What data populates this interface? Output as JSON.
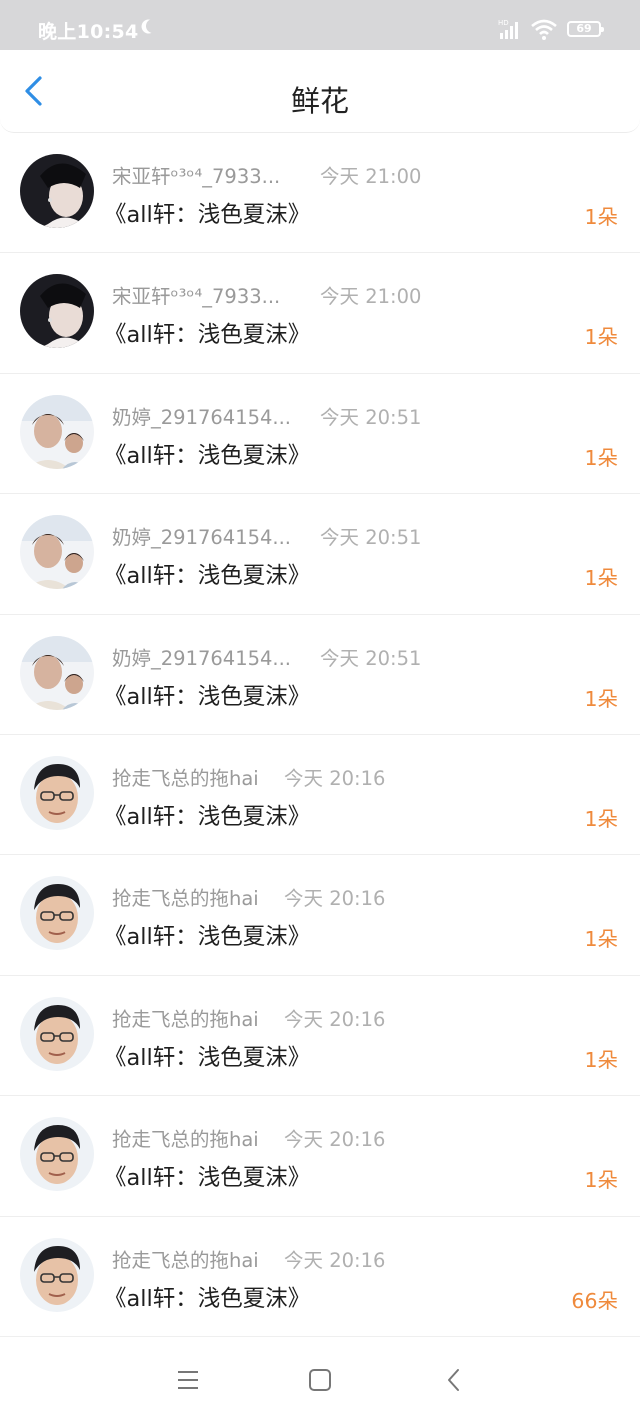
{
  "status_bar": {
    "time": "晚上10:54",
    "battery": "69",
    "icons": [
      "moon-icon",
      "hd-signal-icon",
      "wifi-icon",
      "battery-icon"
    ]
  },
  "header": {
    "title": "鲜花",
    "back_icon": "chevron-left-icon",
    "accent_color": "#2f8ee5"
  },
  "rows": [
    {
      "name": "宋亚轩ᵒ³ᵒ⁴_7933...",
      "time": "今天 21:00",
      "title": "《all轩：浅色夏沫》",
      "count": "1朵",
      "avatar": "a"
    },
    {
      "name": "宋亚轩ᵒ³ᵒ⁴_7933...",
      "time": "今天 21:00",
      "title": "《all轩：浅色夏沫》",
      "count": "1朵",
      "avatar": "a"
    },
    {
      "name": "奶婷_291764154...",
      "time": "今天 20:51",
      "title": "《all轩：浅色夏沫》",
      "count": "1朵",
      "avatar": "b"
    },
    {
      "name": "奶婷_291764154...",
      "time": "今天 20:51",
      "title": "《all轩：浅色夏沫》",
      "count": "1朵",
      "avatar": "b"
    },
    {
      "name": "奶婷_291764154...",
      "time": "今天 20:51",
      "title": "《all轩：浅色夏沫》",
      "count": "1朵",
      "avatar": "b"
    },
    {
      "name": "抢走飞总的拖hai",
      "time": "今天 20:16",
      "title": "《all轩：浅色夏沫》",
      "count": "1朵",
      "avatar": "c"
    },
    {
      "name": "抢走飞总的拖hai",
      "time": "今天 20:16",
      "title": "《all轩：浅色夏沫》",
      "count": "1朵",
      "avatar": "c"
    },
    {
      "name": "抢走飞总的拖hai",
      "time": "今天 20:16",
      "title": "《all轩：浅色夏沫》",
      "count": "1朵",
      "avatar": "c"
    },
    {
      "name": "抢走飞总的拖hai",
      "time": "今天 20:16",
      "title": "《all轩：浅色夏沫》",
      "count": "1朵",
      "avatar": "c"
    },
    {
      "name": "抢走飞总的拖hai",
      "time": "今天 20:16",
      "title": "《all轩：浅色夏沫》",
      "count": "66朵",
      "avatar": "c"
    }
  ],
  "colors": {
    "status_bar_bg": "#d7d7d9",
    "count_orange": "#ef8a3c",
    "name_gray": "#9a9a9a"
  },
  "system_nav": {
    "icons": [
      "menu-icon",
      "home-square-icon",
      "back-triangle-icon"
    ]
  }
}
